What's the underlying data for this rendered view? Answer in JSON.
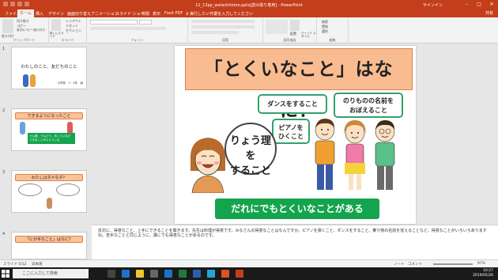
{
  "window": {
    "title": "11_13pp_watashitomo.pptx[読み取り専用] - PowerPoint",
    "signin": "サインイン",
    "controls": [
      "–",
      "□",
      "✕"
    ]
  },
  "ribbon_tabs": [
    "ファイル",
    "ホーム",
    "挿入",
    "デザイン",
    "画面切り替え",
    "アニメーション",
    "スライド ショー",
    "校閲",
    "表示",
    "Foxit PDF",
    "♀ 実行したい作業を入力してください"
  ],
  "share_label": "共有",
  "ribbon": {
    "clipboard": {
      "paste": "貼り付け",
      "cut": "切り取り",
      "copy": "コピー",
      "format": "書式のコピー/貼り付け",
      "label": "クリップボード"
    },
    "slides": {
      "new_slide": "新しいスライド",
      "layout": "レイアウト",
      "reset": "リセット",
      "section": "セクション",
      "label": "スライド"
    },
    "font": {
      "label": "フォント"
    },
    "paragraph": {
      "label": "段落"
    },
    "drawing": {
      "arrange": "配置",
      "styles": "クイック スタイル",
      "label": "図形描画"
    },
    "editing": {
      "find": "検索",
      "replace": "置換",
      "select": "選択",
      "label": "編集"
    }
  },
  "thumbnails": [
    {
      "num": "1",
      "title": "わたしのこと、友だちのこと",
      "sub": "小学校　1・2年　組"
    },
    {
      "num": "2",
      "title": "できるようになったこと",
      "text": "ぺん服、うんどう、みこといなど　できることがふえている"
    },
    {
      "num": "3",
      "title": "わたしはダメな子？"
    },
    {
      "num": "4",
      "title": "「にが手なこと」はなに？"
    }
  ],
  "slide": {
    "title": "「とくいなこと」はなに？",
    "bubble_dance": "ダンスをすること",
    "bubble_names_1": "のりものの名前を",
    "bubble_names_2": "おぼえること",
    "bubble_piano_1": "ピアノを",
    "bubble_piano_2": "ひくこと",
    "bubble_cook_1": "りょう理を",
    "bubble_cook_2": "すること",
    "banner": "だれにでもとくいなことがある"
  },
  "notes": "反対に、得意なこと、上手にできることを聞きます。先生は料理が得意です。みなさんの得意なことはなんですか。ピアノを弾くこと、ダンスをすること、乗り物の名前を覚えることなど、得意なことがいろいろありますね。苦手なことと同じように、誰にでも得意なことがあるのです。",
  "status": {
    "slide_of": "スライド 5/12",
    "language": "日本語",
    "notes_btn": "ノート",
    "comments_btn": "コメント",
    "zoom": "97%"
  },
  "taskbar": {
    "search_placeholder": "ここに入力して検索",
    "time": "10:27",
    "date": "2019/05/26"
  },
  "colors": {
    "accent": "#c43e1c",
    "title_fill": "#f9bc91",
    "banner_green": "#14a44d",
    "bubble_border": "#31a26b"
  }
}
